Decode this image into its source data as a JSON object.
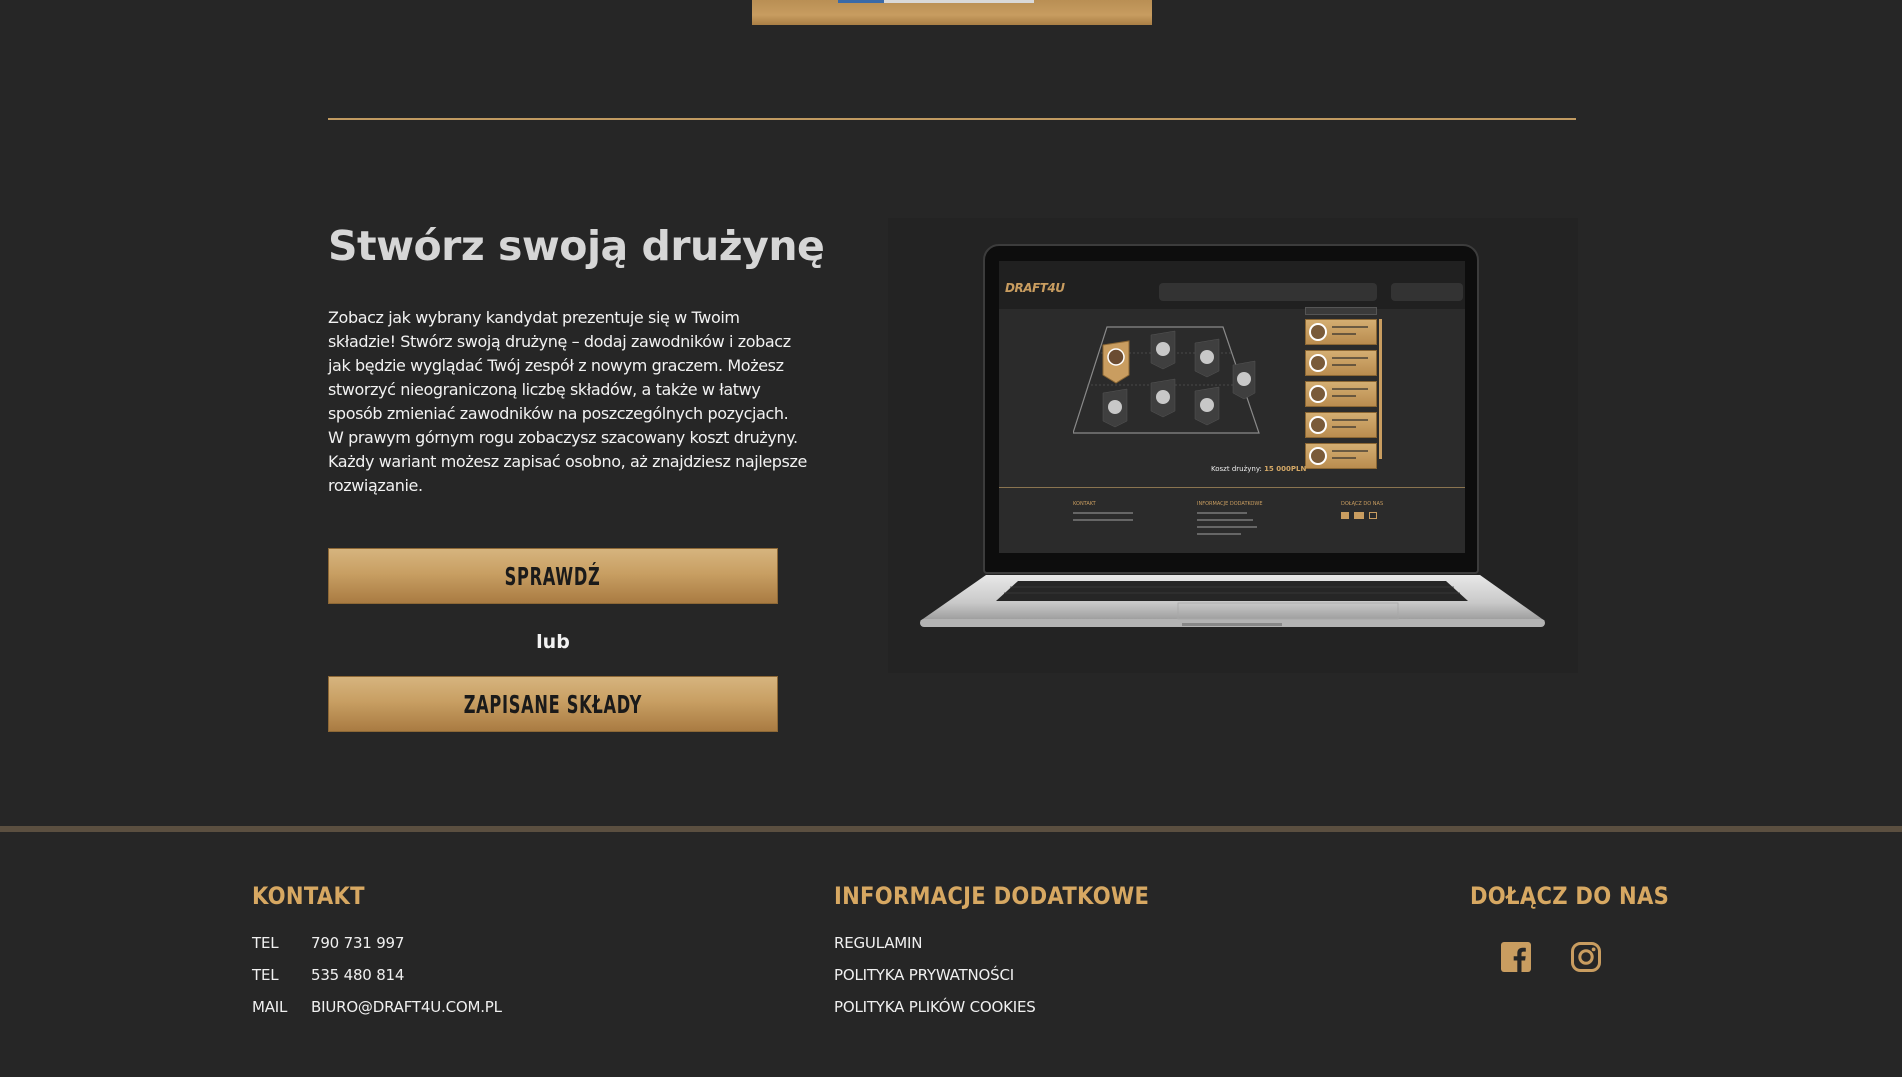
{
  "colors": {
    "background": "#262626",
    "accent_gold": "#c99d60",
    "heading_gold": "#d7a862",
    "text_light": "#f0f0f0"
  },
  "section": {
    "title": "Stwórz swoją drużynę",
    "description": "Zobacz jak wybrany kandydat prezentuje się w Twoim składzie! Stwórz swoją drużynę – dodaj zawodników i zobacz jak będzie wyglądać Twój zespół z nowym graczem. Możesz stworzyć nieograniczoną liczbę składów, a także w łatwy sposób zmieniać zawodników na poszczególnych pozycjach. W prawym górnym rogu zobaczysz szacowany koszt drużyny. Każdy wariant możesz zapisać osobno, aż znajdziesz najlepsze rozwiązanie.",
    "check_button": "SPRAWDŹ",
    "or_label": "lub",
    "saved_button": "ZAPISANE SKŁADY"
  },
  "laptop_preview": {
    "logo": "DRAFT4U",
    "cost_label": "Koszt drużyny:",
    "cost_value": "15 000PLN",
    "footer_kontakt": "KONTAKT",
    "footer_info": "INFORMACJE DODATKOWE",
    "footer_join": "DOŁĄCZ DO NAS"
  },
  "footer": {
    "kontakt": {
      "heading": "KONTAKT",
      "rows": [
        {
          "label": "TEL",
          "value": "790 731 997"
        },
        {
          "label": "TEL",
          "value": "535 480 814"
        },
        {
          "label": "MAIL",
          "value": "BIURO@DRAFT4U.COM.PL"
        }
      ]
    },
    "info": {
      "heading": "INFORMACJE DODATKOWE",
      "links": [
        "REGULAMIN",
        "POLITYKA PRYWATNOŚCI",
        "POLITYKA PLIKÓW COOKIES"
      ]
    },
    "join": {
      "heading": "DOŁĄCZ DO NAS",
      "icons": [
        "facebook-icon",
        "instagram-icon"
      ]
    }
  }
}
